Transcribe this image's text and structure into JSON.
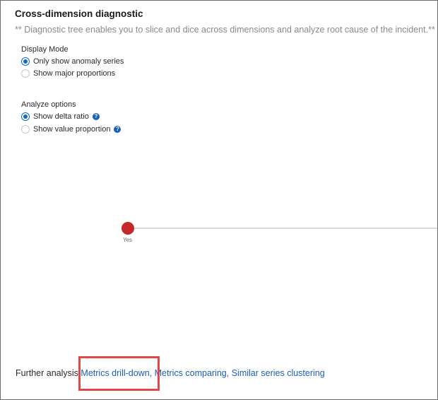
{
  "panel": {
    "title": "Cross-dimension diagnostic",
    "subtitle": "** Diagnostic tree enables you to slice and dice across dimensions and analyze root cause of the incident.**"
  },
  "display_mode": {
    "label": "Display Mode",
    "options": [
      {
        "label": "Only show anomaly series",
        "selected": true
      },
      {
        "label": "Show major proportions",
        "selected": false
      }
    ]
  },
  "analyze_options": {
    "label": "Analyze options",
    "help_glyph": "?",
    "options": [
      {
        "label": "Show delta ratio",
        "selected": true,
        "help_icon": "question-icon"
      },
      {
        "label": "Show value proportion",
        "selected": false,
        "help_icon": "question-icon"
      }
    ]
  },
  "tree": {
    "node_label": "Yes",
    "node_color": "#c62828"
  },
  "further_analysis": {
    "label": "Further analysis",
    "links": [
      "Metrics drill-down,",
      "Metrics comparing,",
      "Similar series clustering"
    ]
  },
  "colors": {
    "accent": "#0f6cbd",
    "link": "#1a5fb4",
    "highlight": "#e04848"
  }
}
